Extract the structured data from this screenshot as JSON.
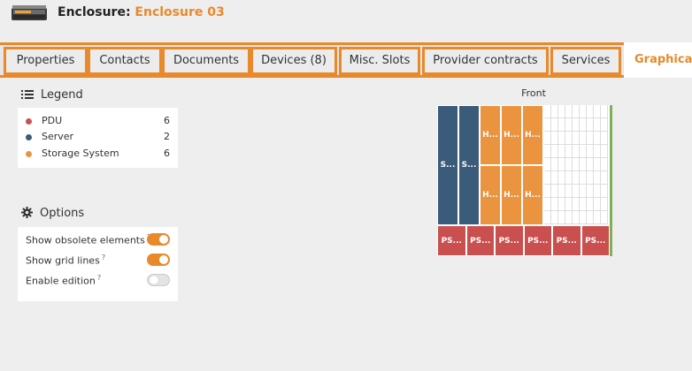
{
  "header": {
    "label": "Enclosure:",
    "name": "Enclosure 03",
    "icon": "enclosure-icon"
  },
  "tabs": [
    {
      "label": "Properties"
    },
    {
      "label": "Contacts"
    },
    {
      "label": "Documents"
    },
    {
      "label": "Devices (8)"
    },
    {
      "label": "Misc. Slots"
    },
    {
      "label": "Provider contracts"
    },
    {
      "label": "Services"
    },
    {
      "label": "Graphical v",
      "active": true
    }
  ],
  "legend": {
    "title": "Legend",
    "items": [
      {
        "label": "PDU",
        "count": "6",
        "color": "#c9504f"
      },
      {
        "label": "Server",
        "count": "2",
        "color": "#3b5b7a"
      },
      {
        "label": "Storage System",
        "count": "6",
        "color": "#ea9440"
      }
    ]
  },
  "options": {
    "title": "Options",
    "items": [
      {
        "label": "Show obsolete elements",
        "hint": "?",
        "state": "on"
      },
      {
        "label": "Show grid lines",
        "hint": "?",
        "state": "on"
      },
      {
        "label": "Enable edition",
        "hint": "?",
        "state": "off"
      }
    ]
  },
  "rack": {
    "label": "Front",
    "servers": [
      "S...",
      "S..."
    ],
    "storage": [
      "H...",
      "H...",
      "H...",
      "H...",
      "H...",
      "H..."
    ],
    "pdus": [
      "PS...",
      "PS...",
      "PS...",
      "PS...",
      "PS...",
      "PS..."
    ]
  },
  "colors": {
    "accent": "#e8892b",
    "pdu": "#c9504f",
    "server": "#3b5b7a",
    "storage": "#ea9440",
    "rail": "#7cb15a"
  }
}
